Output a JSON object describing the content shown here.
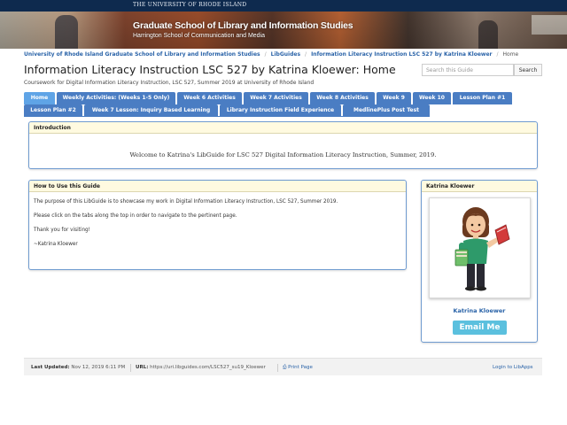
{
  "banner": {
    "university": "THE UNIVERSITY OF RHODE ISLAND",
    "title": "Graduate School of Library and Information Studies",
    "subtitle": "Harrington School of Communication and Media"
  },
  "breadcrumb": [
    "University of Rhode Island Graduate School of Library and Information Studies",
    "LibGuides",
    "Information Literacy Instruction LSC 527 by Katrina Kloewer",
    "Home"
  ],
  "page": {
    "title": "Information Literacy Instruction LSC 527 by Katrina Kloewer: Home",
    "description": "Coursework for Digital Information Literacy Instruction, LSC 527, Summer 2019 at University of Rhode Island"
  },
  "search": {
    "placeholder": "Search this Guide",
    "button_label": "Search"
  },
  "tabs": [
    {
      "label": "Home",
      "active": true
    },
    {
      "label": "Weekly Activities: (Weeks 1-5 Only)"
    },
    {
      "label": "Week 6 Activities"
    },
    {
      "label": "Week 7 Activities"
    },
    {
      "label": "Week 8 Activities"
    },
    {
      "label": "Week 9"
    },
    {
      "label": "Week 10"
    },
    {
      "label": "Lesson Plan #1"
    },
    {
      "label": "Lesson Plan #2"
    },
    {
      "label": "Week 7 Lesson: Inquiry Based Learning"
    },
    {
      "label": "Library Instruction Field Experience"
    },
    {
      "label": "MedlinePlus Post Test"
    }
  ],
  "intro": {
    "heading": "Introduction",
    "text": "Welcome to Katrina's LibGuide for LSC 527 Digital Information Literacy Instruction, Summer, 2019."
  },
  "howto": {
    "heading": "How to Use this Guide",
    "paragraphs": [
      "The purpose of this LibGuide is to showcase my work in Digital Information Literacy Instruction, LSC 527, Summer 2019.",
      "Please click on the tabs along the top in order to navigate to the pertinent page.",
      "Thank you for visiting!",
      "~Katrina Kloewer"
    ]
  },
  "profile": {
    "heading": "Katrina Kloewer",
    "name": "Katrina Kloewer",
    "email_label": "Email Me",
    "avatar_icon": "bitmoji-avatar-icon"
  },
  "footer": {
    "updated_label": "Last Updated:",
    "updated_value": "Nov 12, 2019 6:11 PM",
    "url_label": "URL:",
    "url_value": "https://uri.libguides.com/LSC527_su19_Kloewer",
    "print_label": "Print Page",
    "login_label": "Login to LibApps"
  },
  "colors": {
    "tab": "#4a7dc3",
    "tab_active": "#5fa4e6",
    "link": "#2a63a8",
    "box_header": "#fffae0",
    "email_button": "#5bc0de",
    "topbar": "#0e2a4e"
  }
}
